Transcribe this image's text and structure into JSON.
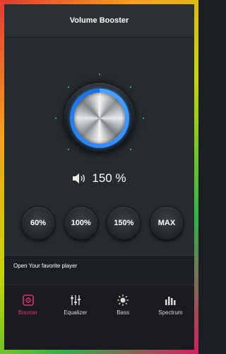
{
  "app": {
    "title": "Volume Booster"
  },
  "volume": {
    "level_label": "150 %",
    "icon": "speaker-icon"
  },
  "presets": [
    {
      "label": "60%"
    },
    {
      "label": "100%"
    },
    {
      "label": "150%"
    },
    {
      "label": "MAX"
    }
  ],
  "player": {
    "open_label": "Open Your favorite player"
  },
  "tabs": [
    {
      "label": "Booster",
      "icon": "booster-icon",
      "active": true
    },
    {
      "label": "Equalizer",
      "icon": "equalizer-icon",
      "active": false
    },
    {
      "label": "Bass",
      "icon": "bass-icon",
      "active": false
    },
    {
      "label": "Spectrum",
      "icon": "spectrum-icon",
      "active": false
    }
  ],
  "colors": {
    "accent": "#e0336f",
    "knob_ring": "#3d8bff",
    "background": "#262b2e"
  }
}
